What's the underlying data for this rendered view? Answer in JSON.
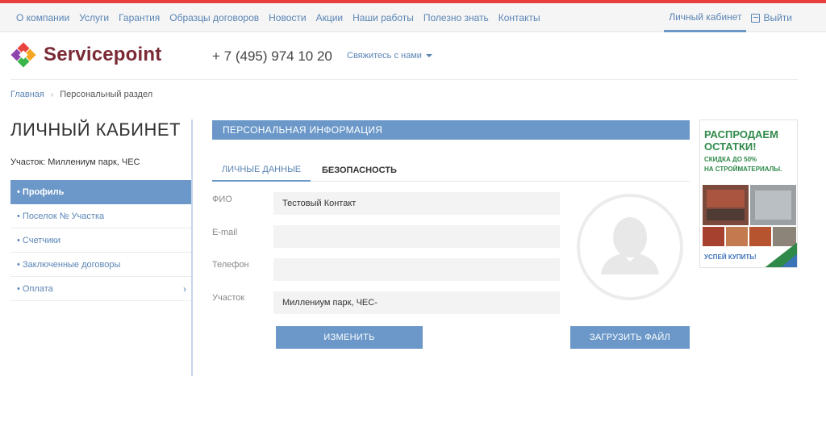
{
  "topnav": {
    "items": [
      "О компании",
      "Услуги",
      "Гарантия",
      "Образцы договоров",
      "Новости",
      "Акции",
      "Наши работы",
      "Полезно знать",
      "Контакты"
    ],
    "cabinet": "Личный кабинет",
    "logout": "Выйти"
  },
  "header": {
    "logo_text": "Servicepoint",
    "phone": "+ 7 (495) 974 10 20",
    "contact_label": "Свяжитесь с нами"
  },
  "breadcrumb": {
    "home": "Главная",
    "current": "Персональный раздел"
  },
  "sidebar": {
    "title": "ЛИЧНЫЙ КАБИНЕТ",
    "plot": "Участок: Миллениум парк, ЧЕС",
    "items": [
      {
        "label": "• Профиль"
      },
      {
        "label": "• Поселок № Участка"
      },
      {
        "label": "• Счетчики"
      },
      {
        "label": "• Заключенные договоры"
      },
      {
        "label": "• Оплата"
      }
    ]
  },
  "main": {
    "section_title": "ПЕРСОНАЛЬНАЯ ИНФОРМАЦИЯ",
    "tabs": [
      "ЛИЧНЫЕ ДАННЫЕ",
      "БЕЗОПАСНОСТЬ"
    ],
    "fields": {
      "fio_label": "ФИО",
      "fio_value": "Тестовый Контакт",
      "email_label": "E-mail",
      "email_value": "",
      "phone_label": "Телефон",
      "phone_value": "",
      "plot_label": "Участок",
      "plot_value": "Миллениум парк, ЧЕС-"
    },
    "buttons": {
      "change": "ИЗМЕНИТЬ",
      "upload": "ЗАГРУЗИТЬ ФАЙЛ"
    }
  },
  "ad": {
    "headline_1": "РАСПРОДАЕМ",
    "headline_2": "ОСТАТКИ!",
    "sub_1": "СКИДКА ДО 50%",
    "sub_2": "НА СТРОЙМАТЕРИАЛЫ.",
    "cta": "УСПЕЙ КУПИТЬ!"
  },
  "colors": {
    "accent": "#6b98c9",
    "link": "#5b85b5",
    "brand": "#7a2a35",
    "top_bar": "#e83e3e",
    "ad_green": "#2f8a4a"
  }
}
